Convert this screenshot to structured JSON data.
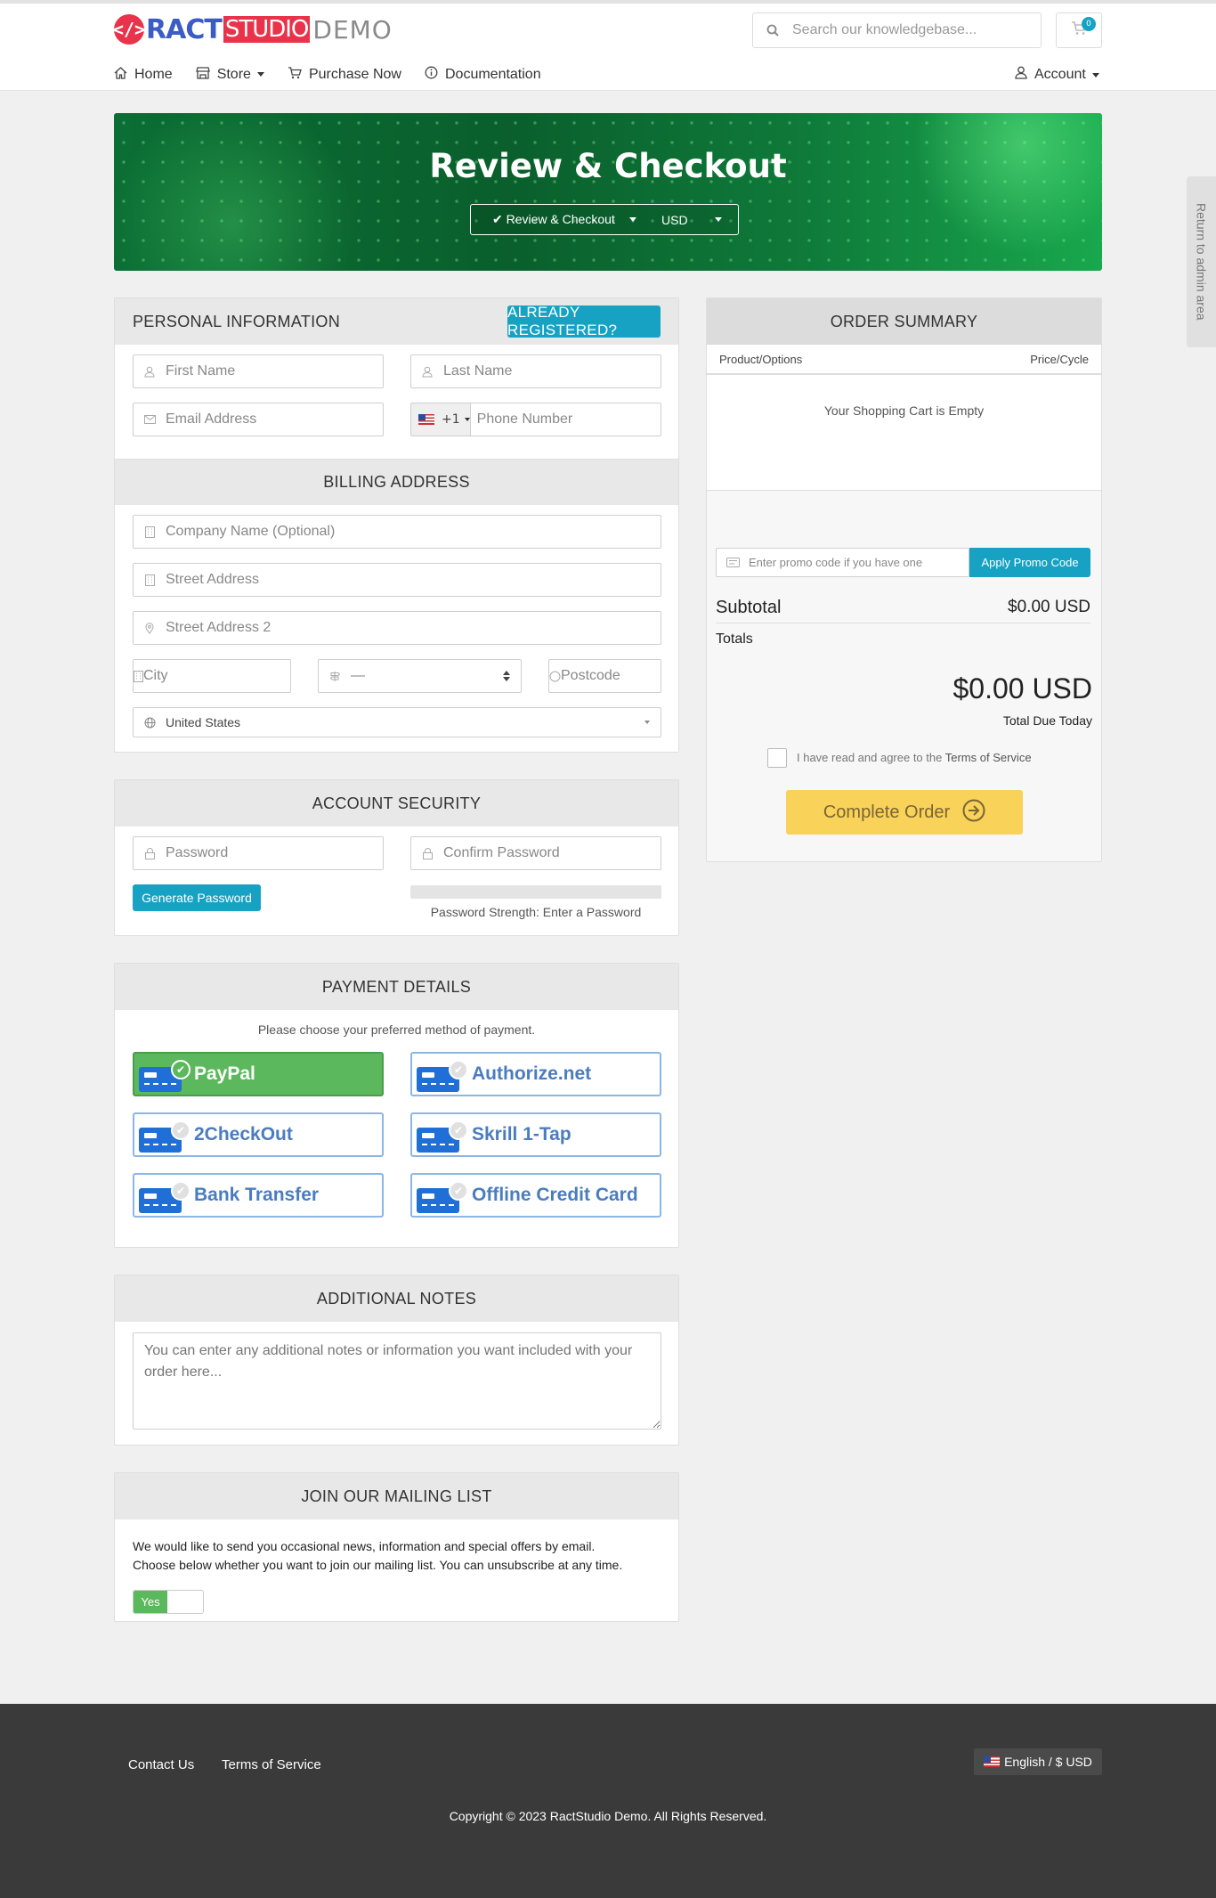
{
  "header": {
    "logo": {
      "mark": "</>",
      "ract": "RACT",
      "studio": "STUDIO",
      "demo": "DEMO"
    },
    "search_placeholder": "Search our knowledgebase...",
    "cart_count": "0",
    "nav": [
      {
        "label": "Home",
        "icon": "home-icon"
      },
      {
        "label": "Store",
        "icon": "store-icon",
        "dropdown": true
      },
      {
        "label": "Purchase Now",
        "icon": "cart-icon"
      },
      {
        "label": "Documentation",
        "icon": "info-icon"
      }
    ],
    "account_label": "Account"
  },
  "banner": {
    "title": "Review & Checkout",
    "breadcrumb": "✔ Review & Checkout",
    "currency": "USD"
  },
  "side_tab": "Return to admin area",
  "personal": {
    "title": "PERSONAL INFORMATION",
    "already_registered": "Already Registered?",
    "first_name_ph": "First Name",
    "last_name_ph": "Last Name",
    "email_ph": "Email Address",
    "phone_code": "+1",
    "phone_ph": "Phone Number"
  },
  "billing": {
    "title": "BILLING ADDRESS",
    "company_ph": "Company Name (Optional)",
    "street_ph": "Street Address",
    "street2_ph": "Street Address 2",
    "city_ph": "City",
    "state_value": "—",
    "postcode_ph": "Postcode",
    "country_value": "United States"
  },
  "security": {
    "title": "ACCOUNT SECURITY",
    "password_ph": "Password",
    "confirm_ph": "Confirm Password",
    "generate_label": "Generate Password",
    "strength_text": "Password Strength: Enter a Password"
  },
  "payment": {
    "title": "PAYMENT DETAILS",
    "prompt": "Please choose your preferred method of payment.",
    "methods": [
      {
        "label": "PayPal",
        "selected": true
      },
      {
        "label": "Authorize.net",
        "selected": false
      },
      {
        "label": "2CheckOut",
        "selected": false
      },
      {
        "label": "Skrill 1-Tap",
        "selected": false
      },
      {
        "label": "Bank Transfer",
        "selected": false
      },
      {
        "label": "Offline Credit Card",
        "selected": false
      }
    ]
  },
  "notes": {
    "title": "ADDITIONAL NOTES",
    "placeholder": "You can enter any additional notes or information you want included with your order here..."
  },
  "mailing": {
    "title": "JOIN OUR MAILING LIST",
    "text1": "We would like to send you occasional news, information and special offers by email.",
    "text2": "Choose below whether you want to join our mailing list. You can unsubscribe at any time.",
    "toggle_label": "Yes"
  },
  "summary": {
    "title": "ORDER SUMMARY",
    "col_product": "Product/Options",
    "col_price": "Price/Cycle",
    "empty_text": "Your Shopping Cart is Empty",
    "promo_ph": "Enter promo code if you have one",
    "apply_label": "Apply Promo Code",
    "subtotal_label": "Subtotal",
    "subtotal_value": "$0.00 USD",
    "totals_label": "Totals",
    "total_value": "$0.00 USD",
    "total_due_label": "Total Due Today",
    "tos_text": "I have read and agree to the",
    "tos_link": "Terms of Service",
    "complete_label": "Complete Order"
  },
  "footer": {
    "links": [
      "Contact Us",
      "Terms of Service"
    ],
    "language": "English / $ USD",
    "copyright": "Copyright © 2023 RactStudio Demo. All Rights Reserved."
  },
  "colors": {
    "accent_teal": "#17a2c4",
    "selected_green": "#5cb85c",
    "complete_yellow": "#f9d259",
    "banner_green": "#0b6e34"
  }
}
